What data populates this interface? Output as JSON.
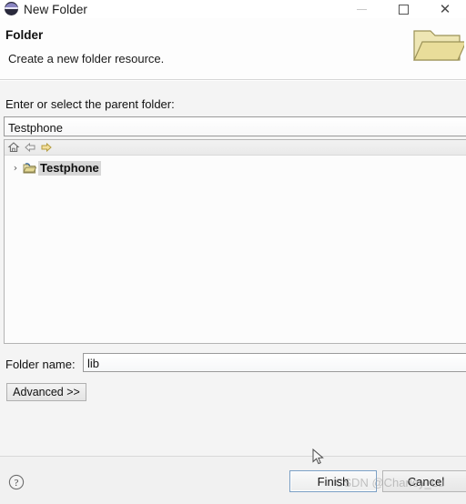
{
  "window": {
    "title": "New Folder",
    "app_icon": "eclipse-icon",
    "controls": {
      "minimize": "minimize-icon",
      "maximize": "maximize-icon",
      "close": "close-icon"
    }
  },
  "header": {
    "title": "Folder",
    "description": "Create a new folder resource.",
    "icon": "open-folder-icon"
  },
  "body": {
    "parent_label": "Enter or select the parent folder:",
    "parent_value": "Testphone",
    "parent_placeholder": "",
    "tree": {
      "toolbar": [
        {
          "name": "home-icon",
          "title": "Home"
        },
        {
          "name": "back-arrow-icon",
          "title": "Back"
        },
        {
          "name": "forward-arrow-icon",
          "title": "Forward"
        }
      ],
      "nodes": [
        {
          "twisty": "›",
          "icon": "project-folder-icon",
          "label": "Testphone",
          "selected": true
        }
      ]
    },
    "foldername_label": "Folder name:",
    "foldername_value": "lib",
    "foldername_placeholder": "",
    "advanced_label": "Advanced >>"
  },
  "footer": {
    "help_icon": "help-icon",
    "finish_label": "Finish",
    "cancel_label": "Cancel"
  },
  "overlay": {
    "watermark": "CSDN @Charley_Lu",
    "cursor": "mouse-pointer-icon"
  },
  "colors": {
    "accent_focus": "#7a9fc4",
    "selection": "#d7d7d7",
    "panel": "#f4f4f4",
    "folder_yellow": "#e8dca0"
  }
}
